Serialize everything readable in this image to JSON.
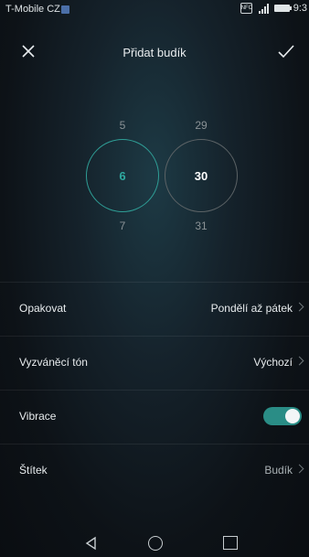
{
  "status_bar": {
    "carrier": "T-Mobile CZ",
    "nfc": "NFC",
    "time": "9:3"
  },
  "header": {
    "title": "Přidat budík"
  },
  "picker": {
    "hour_prev": "5",
    "hour_selected": "6",
    "hour_next": "7",
    "minute_prev": "29",
    "minute_selected": "30",
    "minute_next": "31",
    "hour_color": "#2fa9a0"
  },
  "settings": {
    "repeat": {
      "label": "Opakovat",
      "value": "Pondělí až pátek"
    },
    "ringtone": {
      "label": "Vyzváněcí tón",
      "value": "Výchozí"
    },
    "vibration": {
      "label": "Vibrace",
      "enabled": true
    },
    "label": {
      "label": "Štítek",
      "value": "Budík"
    }
  },
  "colors": {
    "accent": "#2a8d86"
  }
}
